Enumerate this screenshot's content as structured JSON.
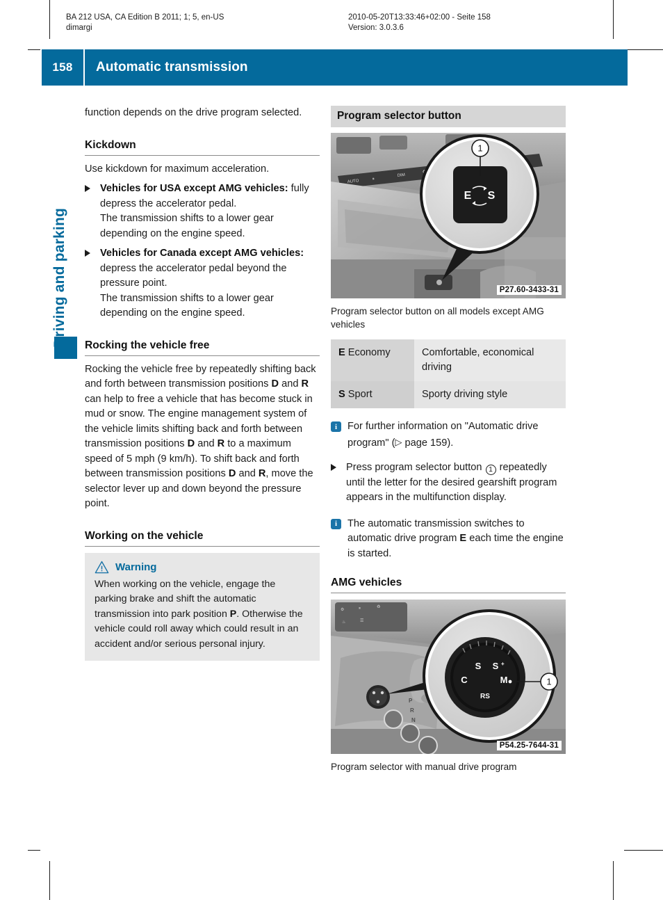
{
  "print_meta": {
    "left_line1": "BA 212 USA, CA Edition B 2011; 1; 5, en-US",
    "left_line2": "dimargi",
    "right_line1": "2010-05-20T13:33:46+02:00 - Seite 158",
    "right_line2": "Version: 3.0.3.6"
  },
  "header": {
    "page_number": "158",
    "title": "Automatic transmission",
    "accent_color": "#046a9c"
  },
  "chapter_tab": {
    "label": "Driving and parking"
  },
  "left_column": {
    "intro": "function depends on the drive program selected.",
    "kickdown": {
      "heading": "Kickdown",
      "lead": "Use kickdown for maximum acceleration.",
      "items": [
        {
          "bold": "Vehicles for USA except AMG vehicles:",
          "rest": " fully depress the accelerator pedal.",
          "extra": "The transmission shifts to a lower gear depending on the engine speed."
        },
        {
          "bold": "Vehicles for Canada except AMG vehicles:",
          "rest": " depress the accelerator pedal beyond the pressure point.",
          "extra": "The transmission shifts to a lower gear depending on the engine speed."
        }
      ]
    },
    "rocking": {
      "heading": "Rocking the vehicle free",
      "body_html": "Rocking the vehicle free by repeatedly shifting back and forth between transmission positions <b>D</b> and <b>R</b> can help to free a vehicle that has become stuck in mud or snow. The engine management system of the vehicle limits shifting back and forth between transmission positions <b>D</b> and <b>R</b> to a maximum speed of 5 mph (9 km/h). To shift back and forth between transmission positions <b>D</b> and <b>R</b>, move the selector lever up and down beyond the pressure point."
    },
    "working": {
      "heading": "Working on the vehicle",
      "warning_label": "Warning",
      "warning_html": "When working on the vehicle, engage the parking brake and shift the automatic transmission into park position <b>P</b>. Otherwise the vehicle could roll away which could result in an accident and/or serious personal injury."
    }
  },
  "right_column": {
    "section_heading": "Program selector button",
    "figure1": {
      "code": "P27.60-3433-31",
      "callout_number": "1",
      "button_labels": [
        "E",
        "S"
      ],
      "caption": "Program selector button on all models except AMG vehicles"
    },
    "table": {
      "rows": [
        {
          "key_bold": "E",
          "key_rest": " Economy",
          "value": "Comfortable, economical driving"
        },
        {
          "key_bold": "S",
          "key_rest": " Sport",
          "value": "Sporty driving style"
        }
      ]
    },
    "note1_html": "For further information on \"Automatic drive program\" (<span class=\"arrow-ref\">&#9655;</span> page 159).",
    "step_html": "Press program selector button <span class=\"circ\">1</span> repeatedly until the letter for the desired gearshift program appears in the multifunction display.",
    "note2_html": "The automatic transmission switches to automatic drive program <b>E</b> each time the engine is started.",
    "amg": {
      "heading": "AMG vehicles",
      "figure2": {
        "code": "P54.25-7644-31",
        "callout_number": "1",
        "dial_labels": [
          "C",
          "S",
          "S+",
          "M",
          "RS"
        ],
        "caption": "Program selector with manual drive program"
      }
    }
  }
}
